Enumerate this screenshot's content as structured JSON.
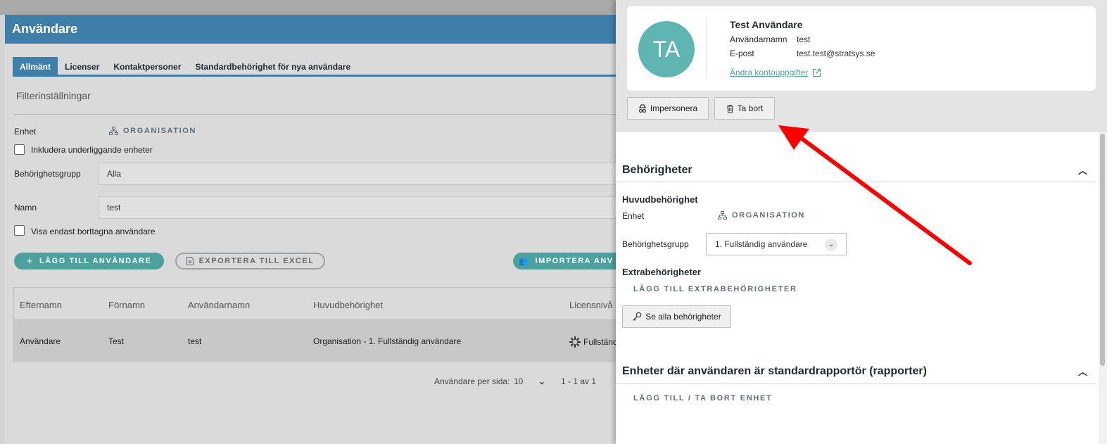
{
  "main": {
    "title": "Användare",
    "tabs": [
      "Allmänt",
      "Licenser",
      "Kontaktpersoner",
      "Standardbehörighet för nya användare"
    ],
    "filter_title": "Filterinställningar",
    "unit_label": "Enhet",
    "unit_value": "ORGANISATION",
    "include_sub_label": "Inkludera underliggande enheter",
    "group_label": "Behörighetsgrupp",
    "group_value": "Alla",
    "name_label": "Namn",
    "name_value": "test",
    "deleted_label": "Visa endast borttagna användare",
    "add_user": "LÄGG TILL ANVÄNDARE",
    "export": "EXPORTERA TILL EXCEL",
    "import": "IMPORTERA ANV",
    "table": {
      "headers": [
        "Efternamn",
        "Förnamn",
        "Användarnamn",
        "Huvudbehörighet",
        "Licensnivå"
      ],
      "rows": [
        [
          "Användare",
          "Test",
          "test",
          "Organisation - 1. Fullständig användare",
          "Fullständ"
        ]
      ]
    },
    "pagination": {
      "per_page_label": "Användare per sida:",
      "per_page": "10",
      "range": "1 - 1 av 1"
    }
  },
  "panel": {
    "initials": "TA",
    "name": "Test Användare",
    "username_label": "Användarnamn",
    "username": "test",
    "email_label": "E-post",
    "email": "test.test@stratsys.se",
    "edit_link": "Ändra kontouppgifter",
    "impersonate": "Impersonera",
    "delete": "Ta bort",
    "perm_title": "Behörigheter",
    "main_perm": "Huvudbehörighet",
    "unit_label": "Enhet",
    "unit_value": "ORGANISATION",
    "group_label": "Behörighetsgrupp",
    "group_value": "1. Fullständig användare",
    "extra_title": "Extrabehörigheter",
    "add_extra": "LÄGG TILL EXTRABEHÖRIGHETER",
    "see_all": "Se alla behörigheter",
    "report_title": "Enheter där användaren är standardrapportör (rapporter)",
    "add_unit": "LÄGG TILL / TA BORT ENHET"
  },
  "colors": {
    "header": "#3d7fa8",
    "accent": "#4aa19d",
    "avatar": "#5eb5b2",
    "annotation": "#ff0000"
  }
}
